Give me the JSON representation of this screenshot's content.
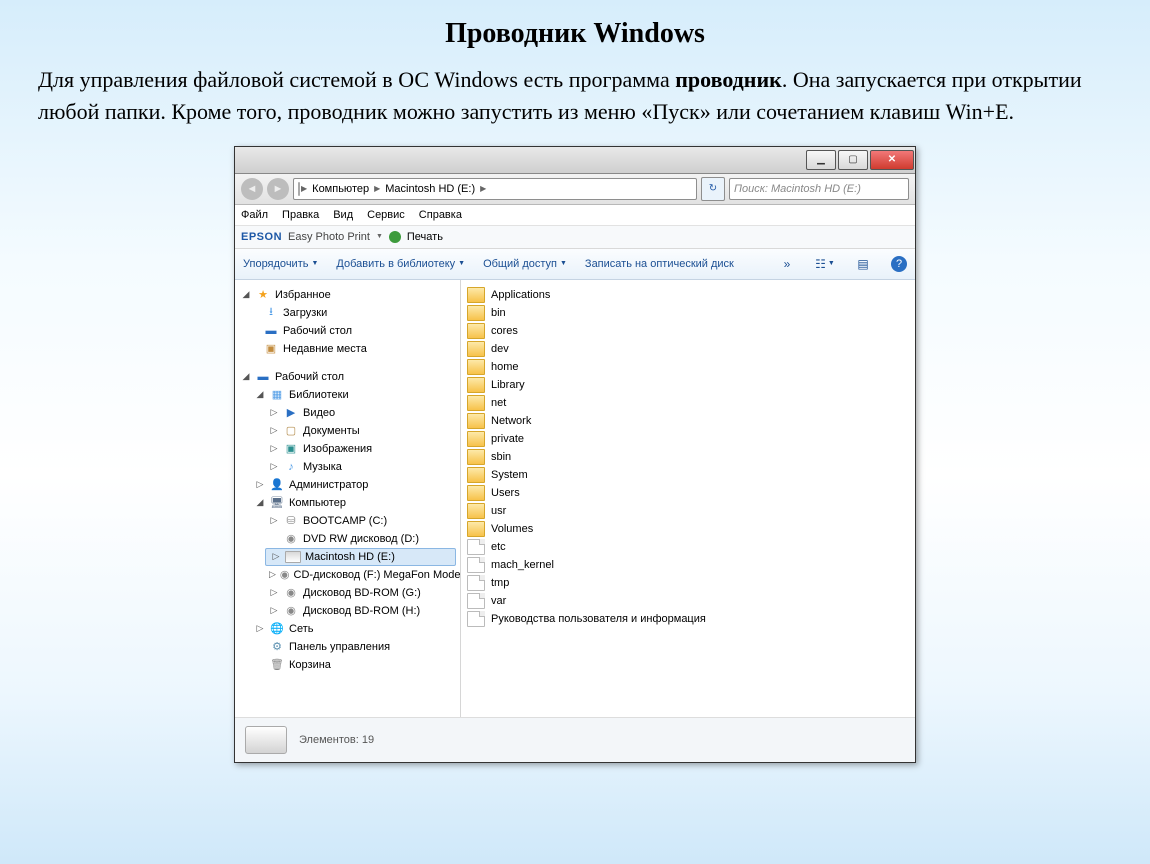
{
  "page": {
    "title": "Проводник Windows",
    "intro": {
      "t1": "Для управления файловой системой в ОС Windows есть программа ",
      "bold": "проводник",
      "t2": ". Она запускается при открытии любой папки. Кроме того, проводник можно запустить из меню «Пуск» или сочетанием клавиш Win+E."
    }
  },
  "nav": {
    "crumbs": [
      "Компьютер",
      "Macintosh HD (E:)"
    ],
    "search_placeholder": "Поиск: Macintosh HD (E:)"
  },
  "menu": [
    "Файл",
    "Правка",
    "Вид",
    "Сервис",
    "Справка"
  ],
  "epson": {
    "brand": "EPSON",
    "product": "Easy Photo Print",
    "print": "Печать"
  },
  "toolbar": [
    "Упорядочить",
    "Добавить в библиотеку",
    "Общий доступ",
    "Записать на оптический диск"
  ],
  "tree": {
    "favorites": {
      "label": "Избранное",
      "items": [
        "Загрузки",
        "Рабочий стол",
        "Недавние места"
      ]
    },
    "desktop": {
      "label": "Рабочий стол",
      "libraries": {
        "label": "Библиотеки",
        "items": [
          "Видео",
          "Документы",
          "Изображения",
          "Музыка"
        ]
      },
      "items": [
        "Администратор",
        "Сеть",
        "Панель управления",
        "Корзина"
      ],
      "computer": {
        "label": "Компьютер",
        "items": [
          "BOOTCAMP (C:)",
          "DVD RW дисковод (D:)",
          "Macintosh HD (E:)",
          "CD-дисковод (F:) MegaFon Modem",
          "Дисковод BD-ROM (G:)",
          "Дисковод BD-ROM (H:)"
        ]
      }
    }
  },
  "files": [
    "Applications",
    "bin",
    "cores",
    "dev",
    "home",
    "Library",
    "net",
    "Network",
    "private",
    "sbin",
    "System",
    "Users",
    "usr",
    "Volumes",
    "etc",
    "mach_kernel",
    "tmp",
    "var",
    "Руководства пользователя и информация"
  ],
  "status": {
    "text": "Элементов: 19"
  }
}
